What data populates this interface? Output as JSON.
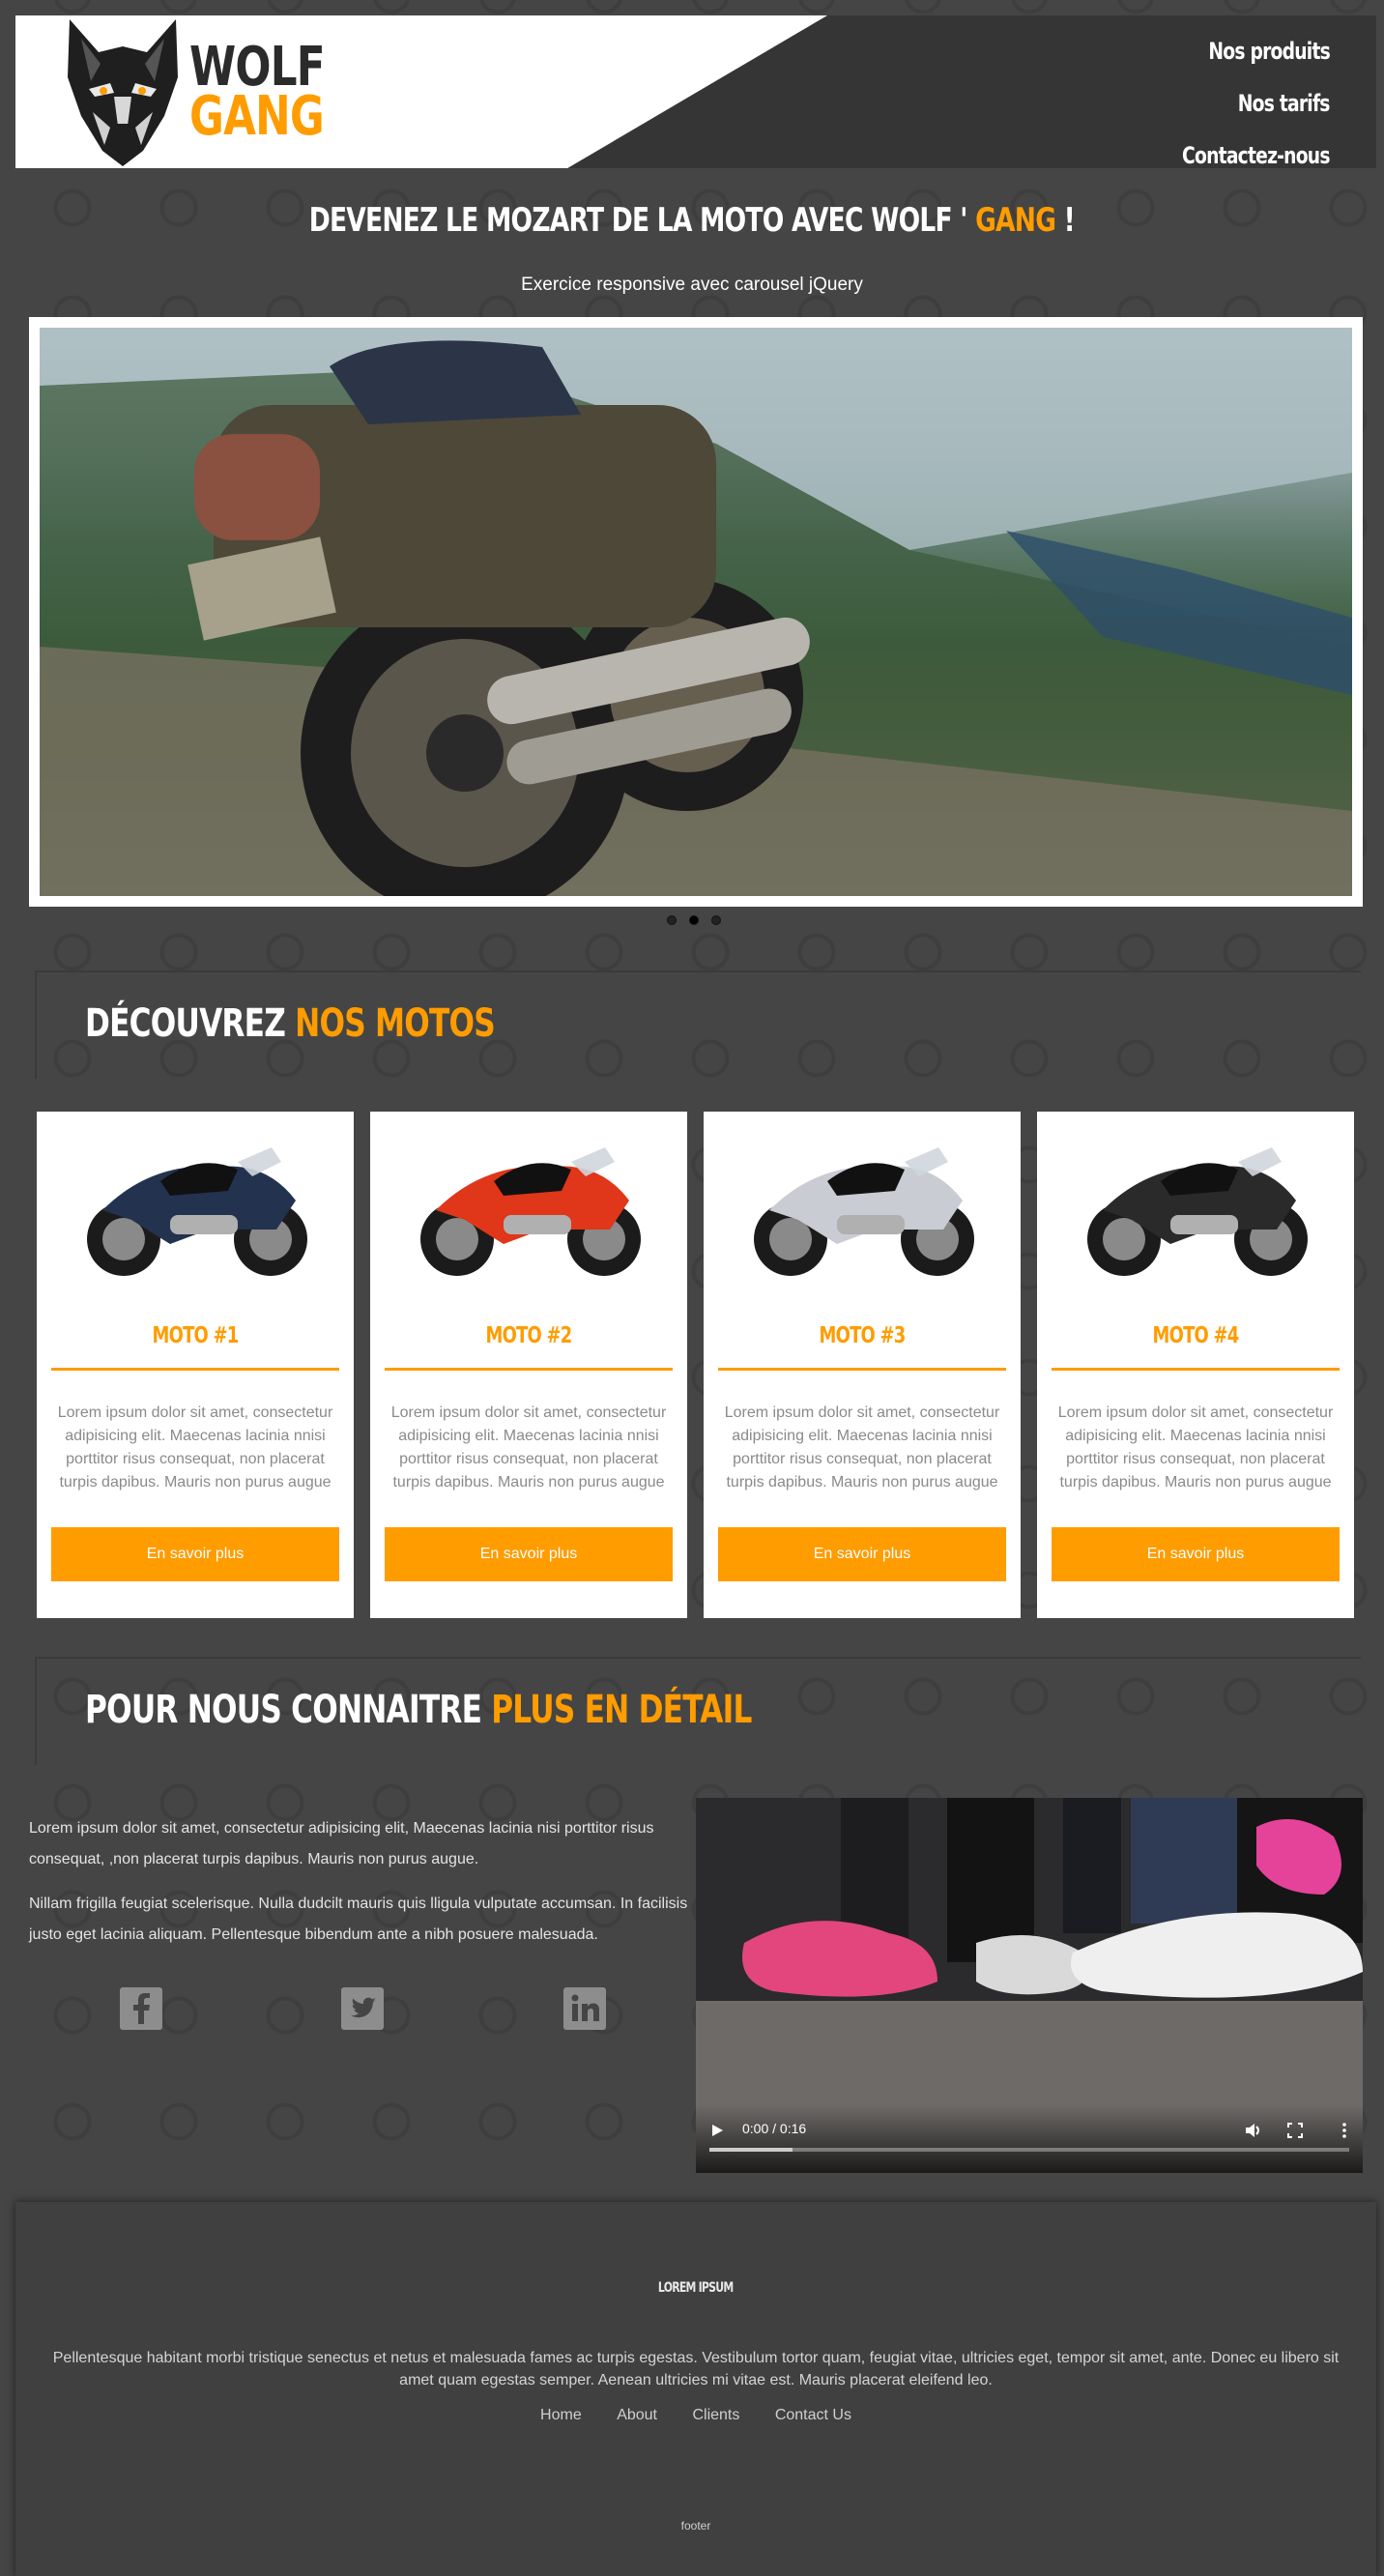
{
  "header": {
    "logo_word1": "WOLF",
    "logo_word2": "GANG",
    "nav": [
      "Nos produits",
      "Nos tarifs",
      "Contactez-nous"
    ]
  },
  "hero": {
    "title_part1": "DEVENEZ LE MOZART DE LA MOTO AVEC WOLF '",
    "title_highlight": "GANG",
    "title_end": "!",
    "subtitle": "Exercice responsive avec carousel jQuery"
  },
  "carousel": {
    "slides_count": 3,
    "active_slide": 2
  },
  "section_motos": {
    "title": "DÉCOUVREZ",
    "highlight": "NOS MOTOS"
  },
  "cards": [
    {
      "title": "MOTO #1",
      "text": "Lorem ipsum dolor sit amet, consectetur adipisicing elit. Maecenas lacinia nnisi porttitor risus consequat, non placerat turpis dapibus. Mauris non purus augue",
      "button": "En savoir plus",
      "bike_color": "#23324f"
    },
    {
      "title": "MOTO #2",
      "text": "Lorem ipsum dolor sit amet, consectetur adipisicing elit. Maecenas lacinia nnisi porttitor risus consequat, non placerat turpis dapibus. Mauris non purus augue",
      "button": "En savoir plus",
      "bike_color": "#e0361a"
    },
    {
      "title": "MOTO #3",
      "text": "Lorem ipsum dolor sit amet, consectetur adipisicing elit. Maecenas lacinia nnisi porttitor risus consequat, non placerat turpis dapibus. Mauris non purus augue",
      "button": "En savoir plus",
      "bike_color": "#c9ccd2"
    },
    {
      "title": "MOTO #4",
      "text": "Lorem ipsum dolor sit amet, consectetur adipisicing elit. Maecenas lacinia nnisi porttitor risus consequat, non placerat turpis dapibus. Mauris non purus augue",
      "button": "En savoir plus",
      "bike_color": "#2a2a2a"
    }
  ],
  "section_about": {
    "title": "POUR NOUS CONNAITRE",
    "highlight": "PLUS EN DÉTAIL"
  },
  "about": {
    "paragraph1": "Lorem ipsum dolor sit amet, consectetur adipisicing elit, Maecenas lacinia nisi porttitor risus consequat, ,non placerat turpis dapibus. Mauris non purus augue.",
    "paragraph2": "Nillam frigilla feugiat scelerisque. Nulla dudcilt mauris quis lligula vulputate accumsan. In facilisis justo eget lacinia aliquam. Pellentesque bibendum ante a nibh posuere malesuada.",
    "social": [
      "facebook-icon",
      "twitter-icon",
      "linkedin-icon"
    ]
  },
  "video": {
    "time": "0:00 / 0:16",
    "progress": 0.13
  },
  "footer": {
    "heading": "LOREM IPSUM",
    "text": "Pellentesque habitant morbi tristique senectus et netus et malesuada fames ac turpis egestas. Vestibulum tortor quam, feugiat vitae, ultricies eget, tempor sit amet, ante. Donec eu libero sit amet quam egestas semper. Aenean ultricies mi vitae est. Mauris placerat eleifend leo.",
    "links": [
      "Home",
      "About",
      "Clients",
      "Contact Us"
    ],
    "bottom": "footer"
  },
  "colors": {
    "accent": "#ff9c00",
    "background": "#454545",
    "header_dark": "#353535"
  }
}
